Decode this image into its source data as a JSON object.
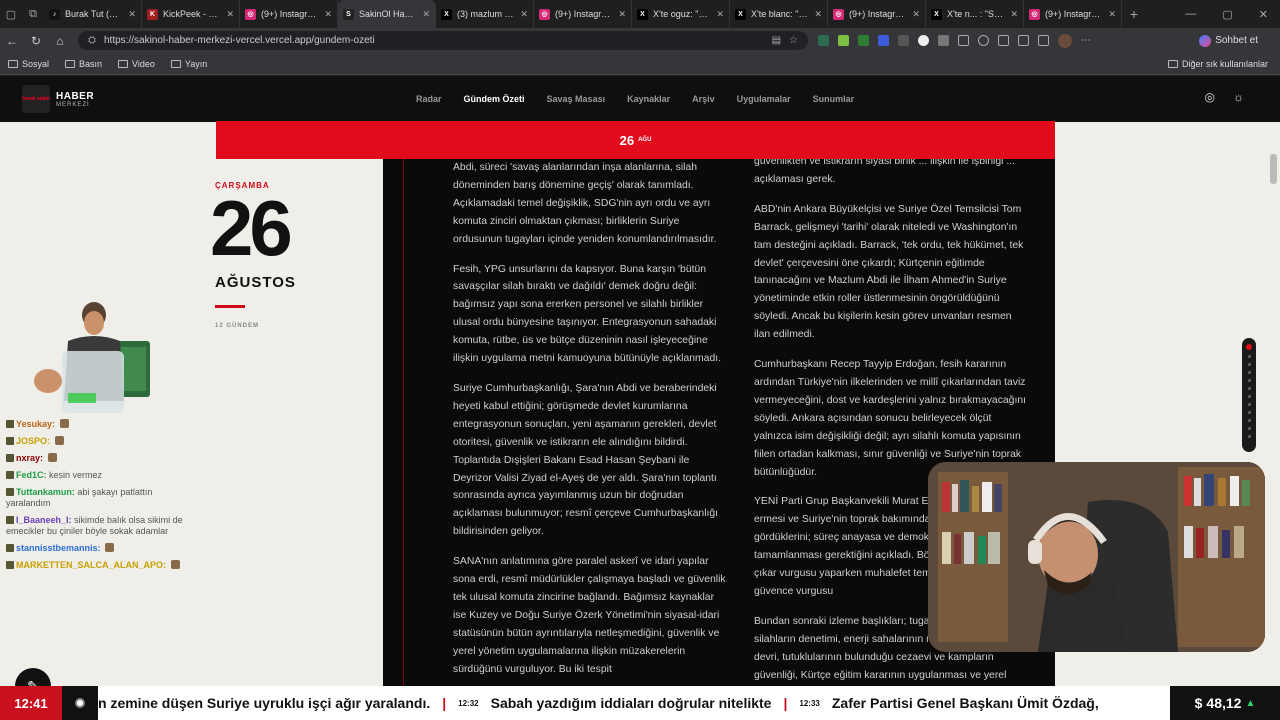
{
  "browser": {
    "tabs": [
      {
        "title": "Burak Tut (@bur...",
        "favicon": "tiktok-icon",
        "color": "#111111",
        "glyph": "♪"
      },
      {
        "title": "KickPeek - Real-ti...",
        "favicon": "kickpeek-icon",
        "color": "#a02020",
        "glyph": "K"
      },
      {
        "title": "(9+) Instagram",
        "favicon": "instagram-icon",
        "color": "#d62976",
        "glyph": "◎"
      },
      {
        "title": "SakinOl Haber M...",
        "favicon": "sakinol-icon",
        "color": "#222222",
        "glyph": "S",
        "active": true
      },
      {
        "title": "(3) mazlum abdi...",
        "favicon": "x-icon",
        "color": "#000000",
        "glyph": "X"
      },
      {
        "title": "(9+) Instagram",
        "favicon": "instagram-icon",
        "color": "#d62976",
        "glyph": "◎"
      },
      {
        "title": "X'te oguz: \"Soy i...",
        "favicon": "x-icon",
        "color": "#000000",
        "glyph": "X"
      },
      {
        "title": "X'te blanc: \"DEFO...",
        "favicon": "x-icon",
        "color": "#000000",
        "glyph": "X"
      },
      {
        "title": "(9+) Instagram",
        "favicon": "instagram-icon",
        "color": "#d62976",
        "glyph": "◎"
      },
      {
        "title": "X'te n... : \"SKWK...",
        "favicon": "x-icon",
        "color": "#000000",
        "glyph": "X"
      },
      {
        "title": "(9+) Instagram",
        "favicon": "instagram-icon",
        "color": "#d62976",
        "glyph": "◎"
      }
    ],
    "url": "https://sakinol-haber-merkezi-vercel.vercel.app/gundem-ozeti",
    "chat_label": "Sohbet et",
    "bookmarks": [
      "Sosyal",
      "Basın",
      "Video",
      "Yayın"
    ],
    "bookmarks_right": "Diğer sık kullanılanlar"
  },
  "site": {
    "logo_top": "HABER",
    "logo_bottom": "MERKEZİ",
    "logo_badge": "burak sakin",
    "menu": [
      "Radar",
      "Gündem Özeti",
      "Savaş Masası",
      "Kaynaklar",
      "Arşiv",
      "Uygulamalar",
      "Sunumlar"
    ],
    "active_menu": "Gündem Özeti",
    "band_day": "26",
    "band_month": "AĞU",
    "weekday": "ÇARŞAMBA",
    "day_number": "26",
    "month_name": "AĞUSTOS",
    "days_count": "12 GÜNDEM"
  },
  "article": {
    "col1": [
      "Abdi, süreci 'savaş alanlarından inşa alanlarına, silah döneminden barış dönemine geçiş' olarak tanımladı. Açıklamadaki temel değişiklik, SDG'nin ayrı ordu ve ayrı komuta zinciri olmaktan çıkması; birliklerin Suriye ordusunun tugayları içinde yeniden konumlandırılmasıdır.",
      "Fesih, YPG unsurlarını da kapsıyor. Buna karşın 'bütün savaşçılar silah bıraktı ve dağıldı' demek doğru değil: bağımsız yapı sona ererken personel ve silahlı birlikler ulusal ordu bünyesine taşınıyor. Entegrasyonun sahadaki komuta, rütbe, üs ve bütçe düzeninin nasıl işleyeceğine ilişkin uygulama metni kamuoyuna bütünüyle açıklanmadı.",
      "Suriye Cumhurbaşkanlığı, Şara'nın Abdi ve beraberindeki heyeti kabul ettiğini; görüşmede devlet kurumlarına entegrasyonun sonuçları, yeni aşamanın gerekleri, devlet otoritesi, güvenlik ve istikrarın ele alındığını bildirdi. Toplantıda Dışişleri Bakanı Esad Hasan Şeybani ile Deyrizor Valisi Ziyad el-Ayeş de yer aldı. Şara'nın toplantı sonrasında ayrıca yayımlanmış uzun bir doğrudan açıklaması bulunmuyor; resmî çerçeve Cumhurbaşkanlığı bildirisinden geliyor.",
      "SANA'nın anlatımına göre paralel askerî ve idari yapılar sona erdi, resmî müdürlükler çalışmaya başladı ve güvenlik tek ulusal komuta zincirine bağlandı. Bağımsız kaynaklar ise Kuzey ve Doğu Suriye Özerk Yönetimi'nin siyasal-idari statüsünün bütün ayrıntılarıyla netleşmediğini, güvenlik ve yerel yönetim uygulamalarına ilişkin müzakerelerin sürdüğünü vurguluyor. Bu iki tespit"
    ],
    "col2": [
      "güvenlikten ve istikrarın siyasi birlik ... ilişkin ile işbirliği ... açıklaması gerek.",
      "ABD'nin Ankara Büyükelçisi ve Suriye Özel Temsilcisi Tom Barrack, gelişmeyi 'tarihi' olarak niteledi ve Washington'ın tam desteğini açıkladı. Barrack, 'tek ordu, tek hükümet, tek devlet' çerçevesini öne çıkardı; Kürtçenin eğitimde tanınacağını ve Mazlum Abdi ile İlham Ahmed'in Suriye yönetiminde etkin roller üstlenmesinin öngörüldüğünü söyledi. Ancak bu kişilerin kesin görev unvanları resmen ilan edilmedi.",
      "Cumhurbaşkanı Recep Tayyip Erdoğan, fesih kararının ardından Türkiye'nin ilkelerinden ve millî çıkarlarından taviz vermeyeceğini, dost ve kardeşlerini yalnız bırakmayacağını söyledi. Ankara açısından sonucu belirleyecek ölçüt yalnızca isim değişikliği değil; ayrı silahlı komuta yapısının fiilen ortadan kalkması, sınır güvenliği ve Suriye'nin toprak bütünlüğüdür.",
      "YENİ Parti Grup Başkanvekili Murat Emir, savaşın sona ermesi ve Suriye'nin toprak bakımından önemli gördüklerini; süreç anayasa ve demokratik seçimlerle tamamlanması gerektiğini açıkladı. Böylece Türkiye'nin millî çıkar vurgusu yaparken muhalefet temsil ve anayasal güvence vurgusu",
      "Bundan sonraki izleme başlıkları; tugay komuta zinciri, ağır silahların denetimi, enerji sahalarının merkezi yönetime devri, tutuklularının bulunduğu cezaevi ve kampların güvenliği, Kürtçe eğitim kararının uygulanması ve yerel yönetimlerin"
    ]
  },
  "chat": [
    {
      "user": "Yesukay:",
      "color": "#b5651d",
      "text": ""
    },
    {
      "user": "JOSPO:",
      "color": "#c8a000",
      "text": ""
    },
    {
      "user": "nxray:",
      "color": "#8b0000",
      "text": ""
    },
    {
      "user": "Fed1C:",
      "color": "#1f9e4a",
      "text": "kesin vermez"
    },
    {
      "user": "Tuttankamun:",
      "color": "#1f9e4a",
      "text": "abi şakayı patlattın yaralandım"
    },
    {
      "user": "I_Baaneeh_I:",
      "color": "#6a3fb5",
      "text": "sikimde balık olsa sikimi de emecikler bu çiniler böyle sokak adamlar"
    },
    {
      "user": "stannisstbemannis:",
      "color": "#2a6fd6",
      "text": ""
    },
    {
      "user": "MARKETTEN_SALCA_ALAN_APO:",
      "color": "#c8a000",
      "text": ""
    }
  ],
  "ticker": {
    "clock": "12:41",
    "items": [
      {
        "time": "",
        "text": "n zemine düşen Suriye uyruklu işçi ağır yaralandı."
      },
      {
        "time": "12:32",
        "text": "Sabah yazdığım iddiaları doğrular nitelikte"
      },
      {
        "time": "12:33",
        "text": "Zafer Partisi Genel Başkanı Ümit Özdağ,"
      }
    ],
    "price_symbol": "$",
    "price": "48,12",
    "price_trend": "▲"
  },
  "colors": {
    "brand_red": "#e10b1c",
    "ticker_red": "#c8101e",
    "page_bg": "#f0eee9",
    "article_bg": "#0a0a0a"
  }
}
